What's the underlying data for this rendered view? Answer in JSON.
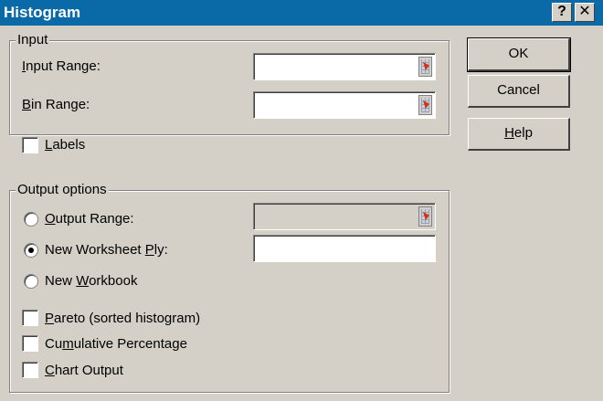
{
  "window": {
    "title": "Histogram",
    "help_glyph": "?",
    "close_glyph": "✕"
  },
  "input_group": {
    "title": "Input",
    "input_range": {
      "prefix": "I",
      "rest": "nput Range:",
      "value": ""
    },
    "bin_range": {
      "prefix": "B",
      "rest": "in Range:",
      "value": ""
    }
  },
  "labels_checkbox": {
    "prefix": "L",
    "rest": "abels",
    "checked": false
  },
  "output_group": {
    "title": "Output options",
    "output_range": {
      "prefix": "O",
      "rest": "utput Range:",
      "selected": false,
      "value": ""
    },
    "new_worksheet": {
      "before": "New Worksheet ",
      "ul": "P",
      "after": "ly:",
      "selected": true,
      "value": ""
    },
    "new_workbook": {
      "before": "New ",
      "ul": "W",
      "after": "orkbook",
      "selected": false
    },
    "pareto": {
      "ul": "P",
      "after": "areto (sorted histogram)",
      "checked": false
    },
    "cumulative": {
      "before": "Cu",
      "ul": "m",
      "after": "ulative Percentage",
      "checked": false
    },
    "chart_output": {
      "ul": "C",
      "after": "hart Output",
      "checked": false
    }
  },
  "buttons": {
    "ok": "OK",
    "cancel": "Cancel",
    "help": {
      "ul": "H",
      "after": "elp"
    }
  },
  "icons": {
    "ref_button": "range-selector-icon",
    "radio_selected": "radio-dot-icon"
  }
}
